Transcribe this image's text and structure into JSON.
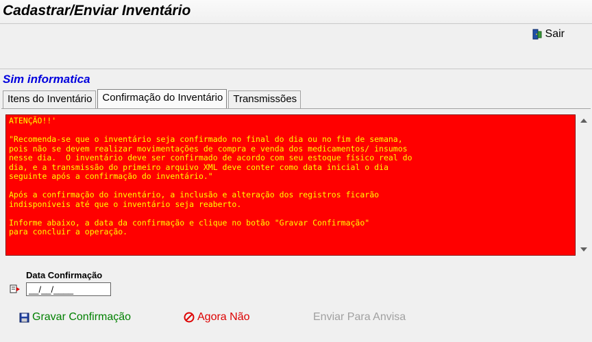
{
  "window": {
    "title": "Cadastrar/Enviar Inventário"
  },
  "toolbar": {
    "exit_label": "Sair"
  },
  "company": {
    "name": "Sim informatica"
  },
  "tabs": [
    {
      "label": "Itens do Inventário"
    },
    {
      "label": "Confirmação do Inventário"
    },
    {
      "label": "Transmissões"
    }
  ],
  "notice": {
    "text": "ATENÇÃO!!'\n\n\"Recomenda-se que o inventário seja confirmado no final do dia ou no fim de semana,\npois não se devem realizar movimentações de compra e venda dos medicamentos/ insumos\nnesse dia.  O inventário deve ser confirmado de acordo com seu estoque físico real do\ndia, e a transmissão do primeiro arquivo XML deve conter como data inicial o dia\nseguinte após a confirmação do inventário.\"\n\nApós a confirmação do inventário, a inclusão e alteração dos registros ficarão\nindisponíveis até que o inventário seja reaberto.\n\nInforme abaixo, a data da confirmação e clique no botão \"Gravar Confirmação\"\npara concluir a operação.",
    "background": "#ff0000",
    "text_color": "#ffff00"
  },
  "form": {
    "date_label": "Data Confirmação",
    "date_value": "__/__/____"
  },
  "actions": {
    "save_label": "Gravar Confirmação",
    "cancel_label": "Agora Não",
    "send_label": "Enviar Para Anvisa"
  },
  "icons": {
    "exit": "exit-door-icon",
    "field": "field-pointer-icon",
    "save": "floppy-disk-icon",
    "cancel": "prohibited-icon"
  }
}
